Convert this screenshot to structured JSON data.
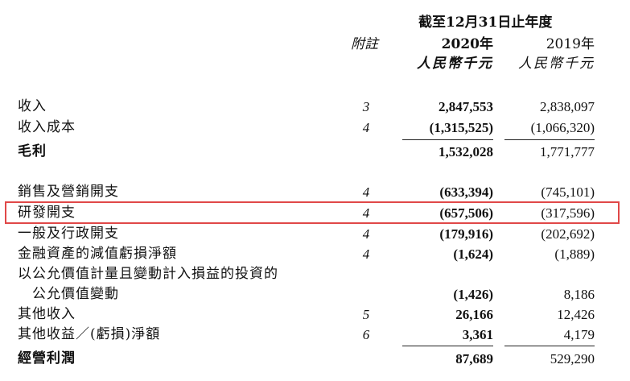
{
  "header": {
    "period_title": "截至12月31日止年度",
    "note_label": "附註",
    "year_2020": "2020年",
    "year_2019": "2019年",
    "unit_2020": "人民幣千元",
    "unit_2019": "人民幣千元"
  },
  "rows": [
    {
      "label": "收入",
      "note": "3",
      "v2020": "2,847,553",
      "v2019": "2,838,097"
    },
    {
      "label": "收入成本",
      "note": "4",
      "v2020": "(1,315,525)",
      "v2019": "(1,066,320)"
    },
    {
      "label": "毛利",
      "note": "",
      "v2020": "1,532,028",
      "v2019": "1,771,777"
    },
    {
      "label": "銷售及營銷開支",
      "note": "4",
      "v2020": "(633,394)",
      "v2019": "(745,101)"
    },
    {
      "label": "研發開支",
      "note": "4",
      "v2020": "(657,506)",
      "v2019": "(317,596)"
    },
    {
      "label": "一般及行政開支",
      "note": "4",
      "v2020": "(179,916)",
      "v2019": "(202,692)"
    },
    {
      "label": "金融資產的減值虧損淨額",
      "note": "4",
      "v2020": "(1,624)",
      "v2019": "(1,889)"
    },
    {
      "label": "以公允價值計量且變動計入損益的投資的",
      "note": "",
      "v2020": "",
      "v2019": ""
    },
    {
      "label": "公允價值變動",
      "note": "",
      "v2020": "(1,426)",
      "v2019": "8,186"
    },
    {
      "label": "其他收入",
      "note": "5",
      "v2020": "26,166",
      "v2019": "12,426"
    },
    {
      "label": "其他收益／(虧損)淨額",
      "note": "6",
      "v2020": "3,361",
      "v2019": "4,179"
    },
    {
      "label": "經營利潤",
      "note": "",
      "v2020": "87,689",
      "v2019": "529,290"
    }
  ],
  "highlight": {
    "color": "#e04848"
  }
}
